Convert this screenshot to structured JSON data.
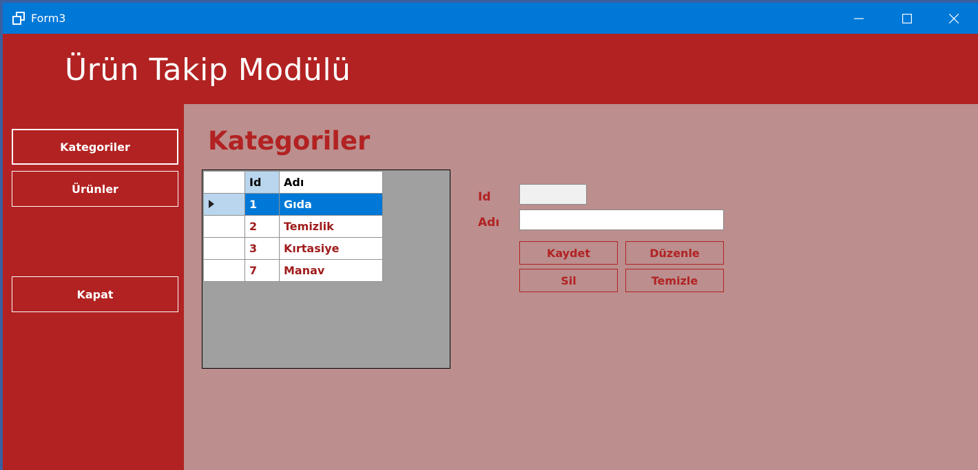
{
  "window": {
    "title": "Form3"
  },
  "header": {
    "title": "Ürün Takip Modülü"
  },
  "sidebar": {
    "items": [
      {
        "label": "Kategoriler"
      },
      {
        "label": "Ürünler"
      },
      {
        "label": "Kapat"
      }
    ]
  },
  "main": {
    "section_title": "Kategoriler",
    "grid": {
      "columns": [
        "Id",
        "Adı"
      ],
      "rows": [
        {
          "id": "1",
          "name": "Gıda"
        },
        {
          "id": "2",
          "name": "Temizlik"
        },
        {
          "id": "3",
          "name": "Kırtasiye"
        },
        {
          "id": "7",
          "name": "Manav"
        }
      ],
      "selected_row": 0
    },
    "form": {
      "id_label": "Id",
      "name_label": "Adı",
      "id_value": "",
      "name_value": ""
    },
    "buttons": {
      "save": "Kaydet",
      "edit": "Düzenle",
      "delete": "Sil",
      "clear": "Temizle"
    }
  },
  "colors": {
    "primary_red": "#b22222",
    "content_bg": "#bc8e8e",
    "titlebar": "#0078d7",
    "selection": "#0078d7"
  }
}
